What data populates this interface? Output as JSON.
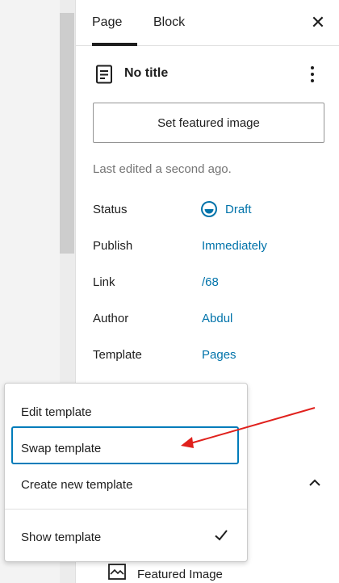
{
  "tabs": {
    "page": "Page",
    "block": "Block",
    "close": "✕"
  },
  "document": {
    "title": "No title",
    "icon": "document-icon"
  },
  "featured_button": "Set featured image",
  "last_edited": "Last edited a second ago.",
  "rows": {
    "status": {
      "label": "Status",
      "value": "Draft"
    },
    "publish": {
      "label": "Publish",
      "value": "Immediately"
    },
    "link": {
      "label": "Link",
      "value": "/68"
    },
    "author": {
      "label": "Author",
      "value": "Abdul"
    },
    "template": {
      "label": "Template",
      "value": "Pages"
    }
  },
  "menu": {
    "edit": "Edit template",
    "swap": "Swap template",
    "create": "Create new template",
    "show": "Show template",
    "show_checked": true
  },
  "featured_image_section": "Featured Image",
  "colors": {
    "accent": "#0073aa",
    "focus": "#007cba",
    "annotation_arrow": "#e0201c"
  }
}
